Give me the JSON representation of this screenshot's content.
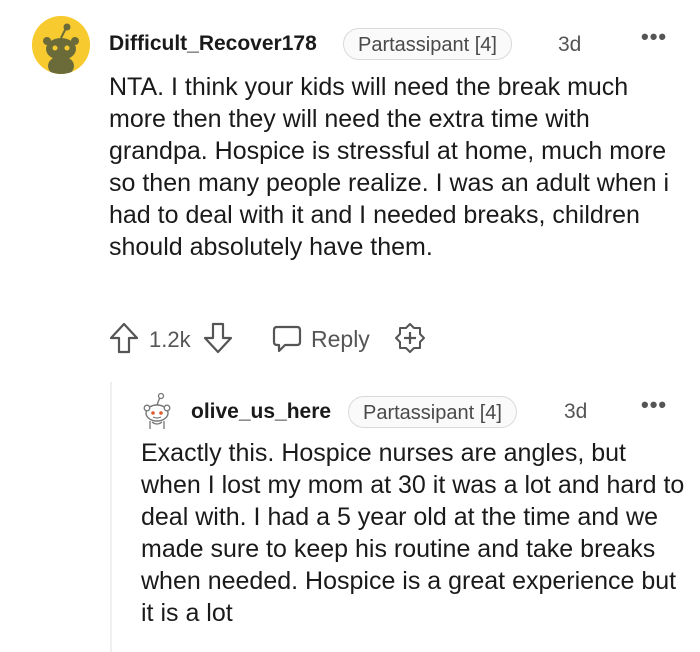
{
  "comments": [
    {
      "username": "Difficult_Recover178",
      "flair": "Partassipant [4]",
      "age": "3d",
      "more": "•••",
      "body": "NTA. I think your kids will need the break much more then they will need the extra time with grandpa. Hospice is stressful at home, much more so then many people realize. I was an adult when i had to deal with it and I needed breaks, children should absolutely have them.",
      "score": "1.2k",
      "reply_label": "Reply",
      "avatar_color": "#f7cb2f"
    },
    {
      "username": "olive_us_here",
      "flair": "Partassipant [4]",
      "age": "3d",
      "more": "•••",
      "body": "Exactly this. Hospice nurses are angles, but when I lost my mom at 30 it was a lot and hard to deal with. I had a 5 year old at the time and we made sure to keep his routine and take breaks when needed. Hospice is a great experience but it is a lot"
    }
  ],
  "icons": {
    "upvote": "upvote-icon",
    "downvote": "downvote-icon",
    "reply": "reply-icon",
    "award": "award-icon",
    "more": "more-options-icon"
  }
}
